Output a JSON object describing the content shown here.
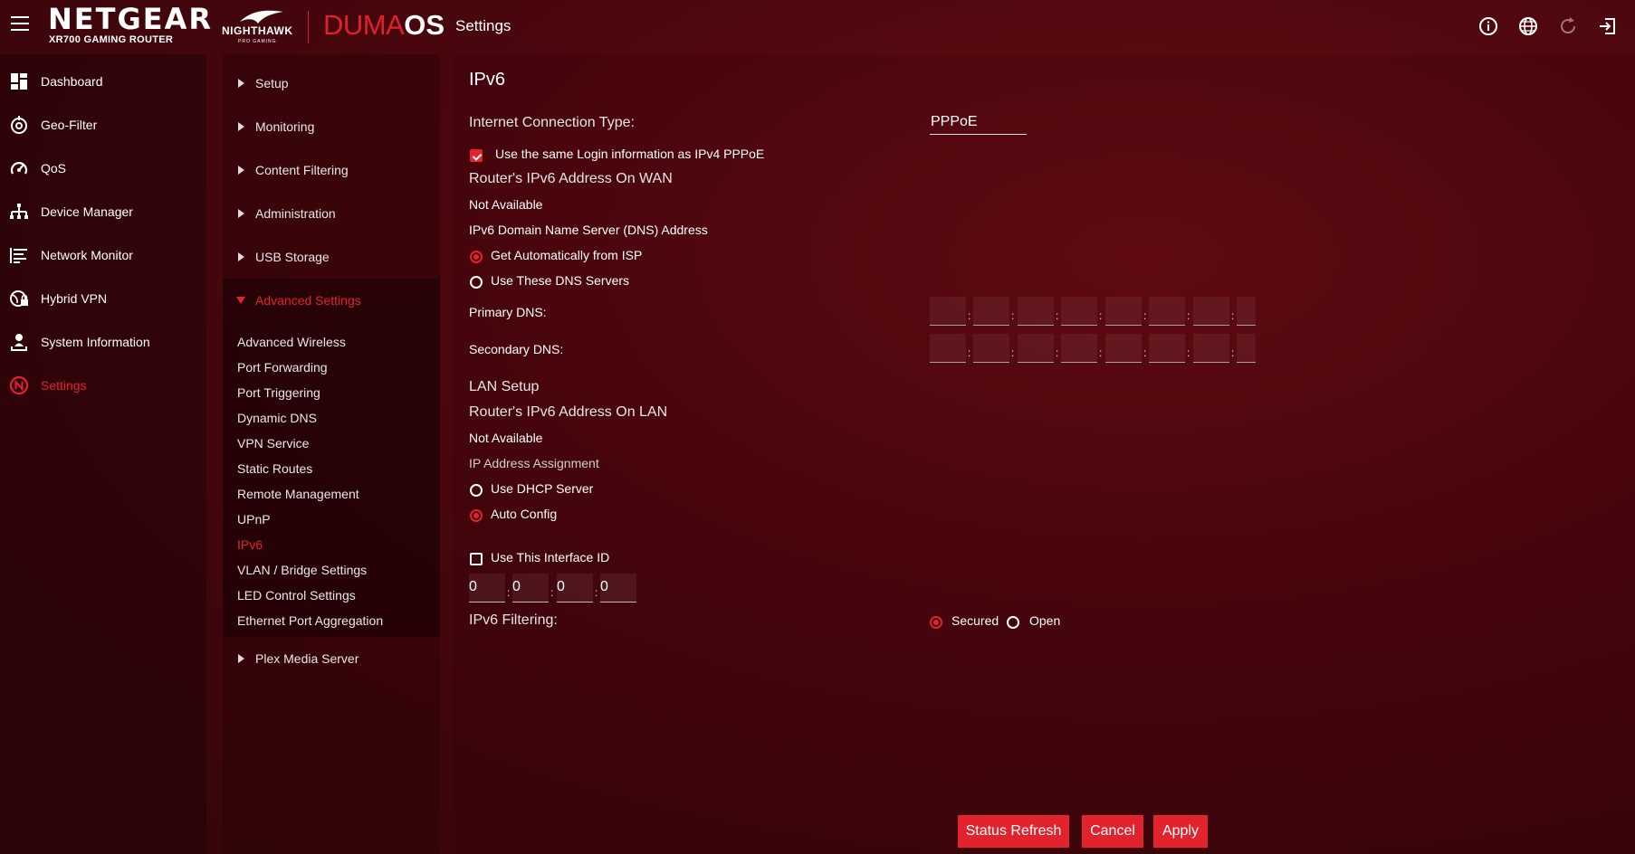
{
  "header": {
    "brand": "NETGEAR",
    "model": "XR700 GAMING ROUTER",
    "nighthawk": "NIGHTHAWK",
    "nighthawk_sub": "PRO GAMING",
    "os_part1": "DUMA",
    "os_part2": "OS",
    "page": "Settings",
    "icons": [
      "info-icon",
      "globe-icon",
      "refresh-icon",
      "logout-icon"
    ]
  },
  "leftnav": [
    {
      "label": "Dashboard",
      "icon": "dashboard-icon"
    },
    {
      "label": "Geo-Filter",
      "icon": "geo-filter-icon"
    },
    {
      "label": "QoS",
      "icon": "qos-icon"
    },
    {
      "label": "Device Manager",
      "icon": "device-manager-icon"
    },
    {
      "label": "Network Monitor",
      "icon": "network-monitor-icon"
    },
    {
      "label": "Hybrid VPN",
      "icon": "hybrid-vpn-icon"
    },
    {
      "label": "System Information",
      "icon": "system-information-icon"
    },
    {
      "label": "Settings",
      "icon": "settings-icon",
      "active": true
    }
  ],
  "midnav": {
    "sections": [
      "Setup",
      "Monitoring",
      "Content Filtering",
      "Administration",
      "USB Storage"
    ],
    "advanced_label": "Advanced Settings",
    "advanced_items": [
      "Advanced Wireless",
      "Port Forwarding",
      "Port Triggering",
      "Dynamic DNS",
      "VPN Service",
      "Static Routes",
      "Remote Management",
      "UPnP",
      "IPv6",
      "VLAN / Bridge Settings",
      "LED Control Settings",
      "Ethernet Port Aggregation"
    ],
    "active_item": "IPv6",
    "last_section": "Plex Media Server"
  },
  "main": {
    "title": "IPv6",
    "connection_type_label": "Internet Connection Type:",
    "connection_type_value": "PPPoE",
    "same_login_label": "Use the same Login information as IPv4 PPPoE",
    "same_login_checked": true,
    "wan_addr_label": "Router's IPv6 Address On WAN",
    "wan_addr_value": "Not Available",
    "dns_label": "IPv6 Domain Name Server (DNS) Address",
    "dns_auto_label": "Get Automatically from ISP",
    "dns_manual_label": "Use These DNS Servers",
    "dns_selected": "auto",
    "primary_dns_label": "Primary DNS:",
    "secondary_dns_label": "Secondary DNS:",
    "lan_setup_label": "LAN Setup",
    "lan_addr_label": "Router's IPv6 Address On LAN",
    "lan_addr_value": "Not Available",
    "ip_assign_label": "IP Address Assignment",
    "dhcp_label": "Use DHCP Server",
    "auto_config_label": "Auto Config",
    "assign_selected": "auto",
    "interface_id_label": "Use This Interface ID",
    "interface_id_checked": false,
    "interface_id": [
      "0",
      "0",
      "0",
      "0"
    ],
    "filtering_label": "IPv6 Filtering:",
    "secured_label": "Secured",
    "open_label": "Open",
    "filtering_selected": "secured"
  },
  "buttons": {
    "status_refresh": "Status Refresh",
    "cancel": "Cancel",
    "apply": "Apply"
  },
  "colors": {
    "accent": "#e2232e",
    "background": "#4a070d"
  }
}
